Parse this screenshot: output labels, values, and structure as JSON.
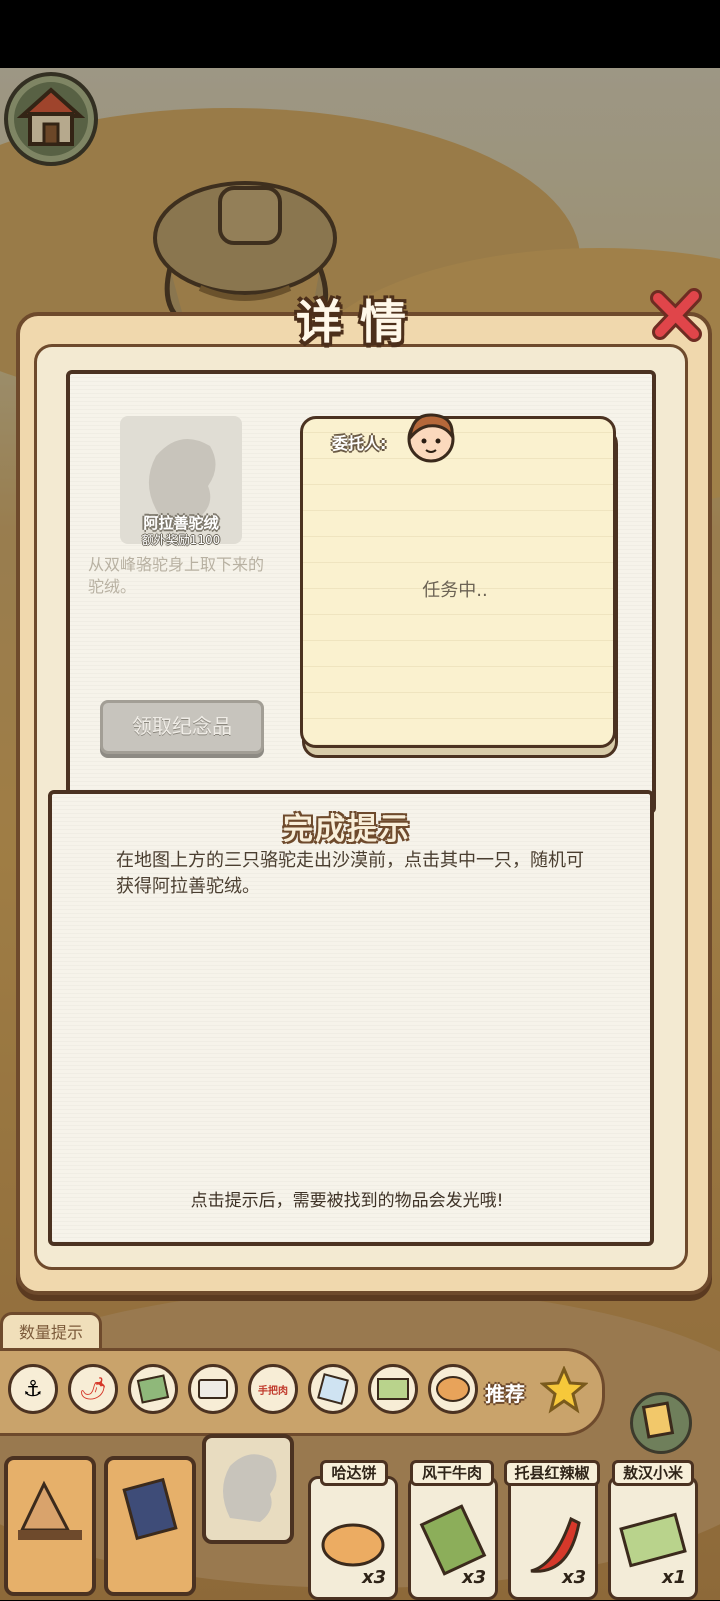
{
  "dialog": {
    "title": "详情",
    "item": {
      "name": "阿拉善驼绒",
      "reward": "额外奖励1100",
      "description": "从双峰骆驼身上取下来的驼绒。"
    },
    "claim_button": "领取纪念品",
    "client_label": "委托人:",
    "task_status": "任务中..",
    "hint": {
      "title": "完成提示",
      "text": "在地图上方的三只骆驼走出沙漠前，点击其中一只，随机可获得阿拉善驼绒。",
      "footer": "点击提示后，需要被找到的物品会发光哦!"
    }
  },
  "toolbar": {
    "count_hint_tab": "数量提示",
    "recommend_label": "推荐",
    "tools": [
      "anchor-icon",
      "chili-icon",
      "snack-bag-icon",
      "tofu-icon",
      "canned-meat-icon",
      "milk-pack-icon",
      "millet-pack-icon",
      "pastry-icon"
    ],
    "tool_text": {
      "canned_meat": "手把肉"
    }
  },
  "wanted_items": [
    {
      "label": "哈达饼",
      "count": "x3"
    },
    {
      "label": "风干牛肉",
      "count": "x3"
    },
    {
      "label": "托县红辣椒",
      "count": "x3"
    },
    {
      "label": "敖汉小米",
      "count": "x1"
    }
  ],
  "colors": {
    "panel": "#f0d8ad",
    "border": "#6e4a2c",
    "note": "#faf1cf",
    "close": "#e0454a"
  }
}
